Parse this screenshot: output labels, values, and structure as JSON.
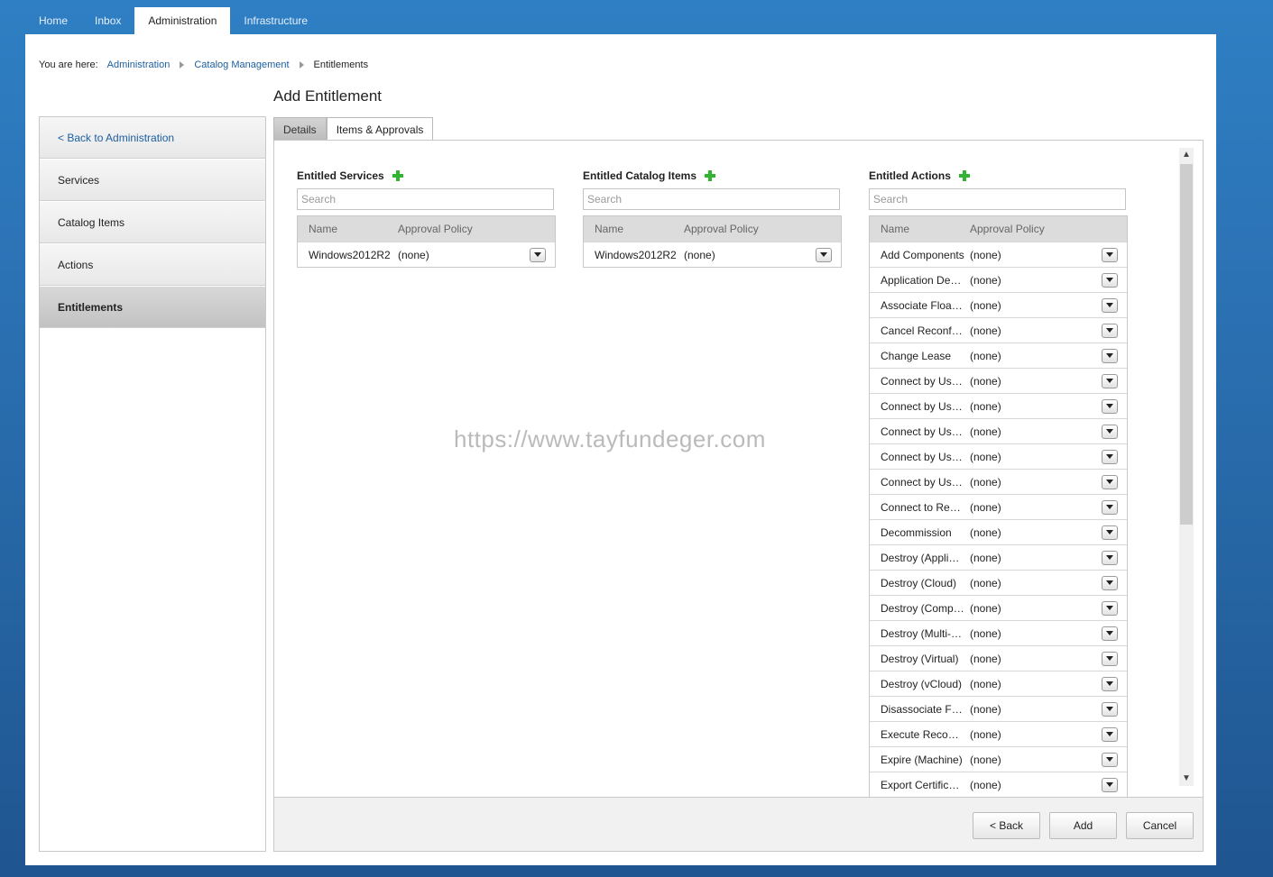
{
  "topnav": [
    "Home",
    "Inbox",
    "Administration",
    "Infrastructure"
  ],
  "breadcrumb": {
    "prefix": "You are here:",
    "items": [
      "Administration",
      "Catalog Management"
    ],
    "current": "Entitlements"
  },
  "page_title": "Add Entitlement",
  "sidebar": {
    "back": "< Back to Administration",
    "items": [
      "Services",
      "Catalog Items",
      "Actions",
      "Entitlements"
    ],
    "active": "Entitlements"
  },
  "tabs": [
    "Details",
    "Items & Approvals"
  ],
  "active_tab": "Items & Approvals",
  "columns": {
    "services": {
      "title": "Entitled Services",
      "search_placeholder": "Search",
      "header_name": "Name",
      "header_policy": "Approval Policy",
      "rows": [
        {
          "name": "Windows2012R2",
          "policy": "(none)"
        }
      ]
    },
    "catalog": {
      "title": "Entitled Catalog Items",
      "search_placeholder": "Search",
      "header_name": "Name",
      "header_policy": "Approval Policy",
      "rows": [
        {
          "name": "Windows2012R2",
          "policy": "(none)"
        }
      ]
    },
    "actions": {
      "title": "Entitled Actions",
      "search_placeholder": "Search",
      "header_name": "Name",
      "header_policy": "Approval Policy",
      "rows": [
        {
          "name": "Add Components",
          "policy": "(none)"
        },
        {
          "name": "Application Deployment",
          "policy": "(none)"
        },
        {
          "name": "Associate Floating IP",
          "policy": "(none)"
        },
        {
          "name": "Cancel Reconfigure",
          "policy": "(none)"
        },
        {
          "name": "Change Lease",
          "policy": "(none)"
        },
        {
          "name": "Connect by Using RDP",
          "policy": "(none)"
        },
        {
          "name": "Connect by Using SSH",
          "policy": "(none)"
        },
        {
          "name": "Connect by Using VNC",
          "policy": "(none)"
        },
        {
          "name": "Connect by Using ARD",
          "policy": "(none)"
        },
        {
          "name": "Connect by Using Citrix",
          "policy": "(none)"
        },
        {
          "name": "Connect to Remote Console",
          "policy": "(none)"
        },
        {
          "name": "Decommission",
          "policy": "(none)"
        },
        {
          "name": "Destroy (Application)",
          "policy": "(none)"
        },
        {
          "name": "Destroy (Cloud)",
          "policy": "(none)"
        },
        {
          "name": "Destroy (Composite)",
          "policy": "(none)"
        },
        {
          "name": "Destroy (Multi-Machine)",
          "policy": "(none)"
        },
        {
          "name": "Destroy (Virtual)",
          "policy": "(none)"
        },
        {
          "name": "Destroy (vCloud)",
          "policy": "(none)"
        },
        {
          "name": "Disassociate Floating IP",
          "policy": "(none)"
        },
        {
          "name": "Execute Reconfigure",
          "policy": "(none)"
        },
        {
          "name": "Expire (Machine)",
          "policy": "(none)"
        },
        {
          "name": "Export Certificates",
          "policy": "(none)"
        }
      ]
    }
  },
  "footer": {
    "back": "< Back",
    "add": "Add",
    "cancel": "Cancel"
  },
  "watermark": "https://www.tayfundeger.com"
}
